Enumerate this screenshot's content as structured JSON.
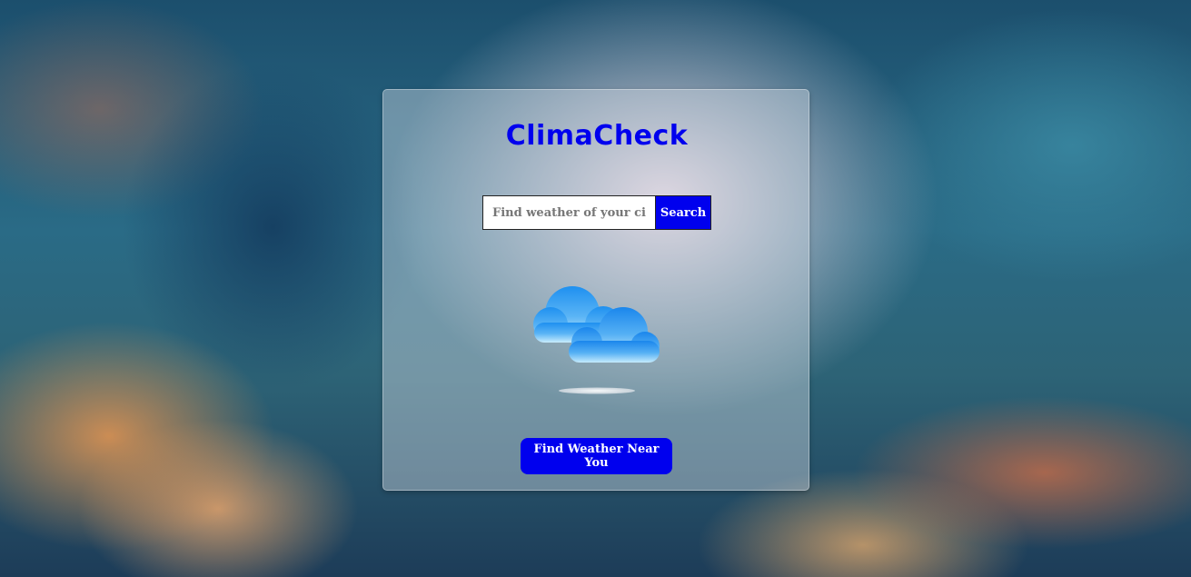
{
  "app": {
    "title": "ClimaCheck"
  },
  "search": {
    "placeholder": "Find weather of your city",
    "value": "",
    "button_label": "Search"
  },
  "weather": {
    "icon": "cloudy-icon"
  },
  "locate": {
    "button_label": "Find Weather Near You"
  },
  "colors": {
    "accent": "#0000ee",
    "card_background": "rgba(215,222,232,0.42)",
    "cloud_top": "#1e90f0",
    "cloud_bottom": "#bfe6fb"
  }
}
